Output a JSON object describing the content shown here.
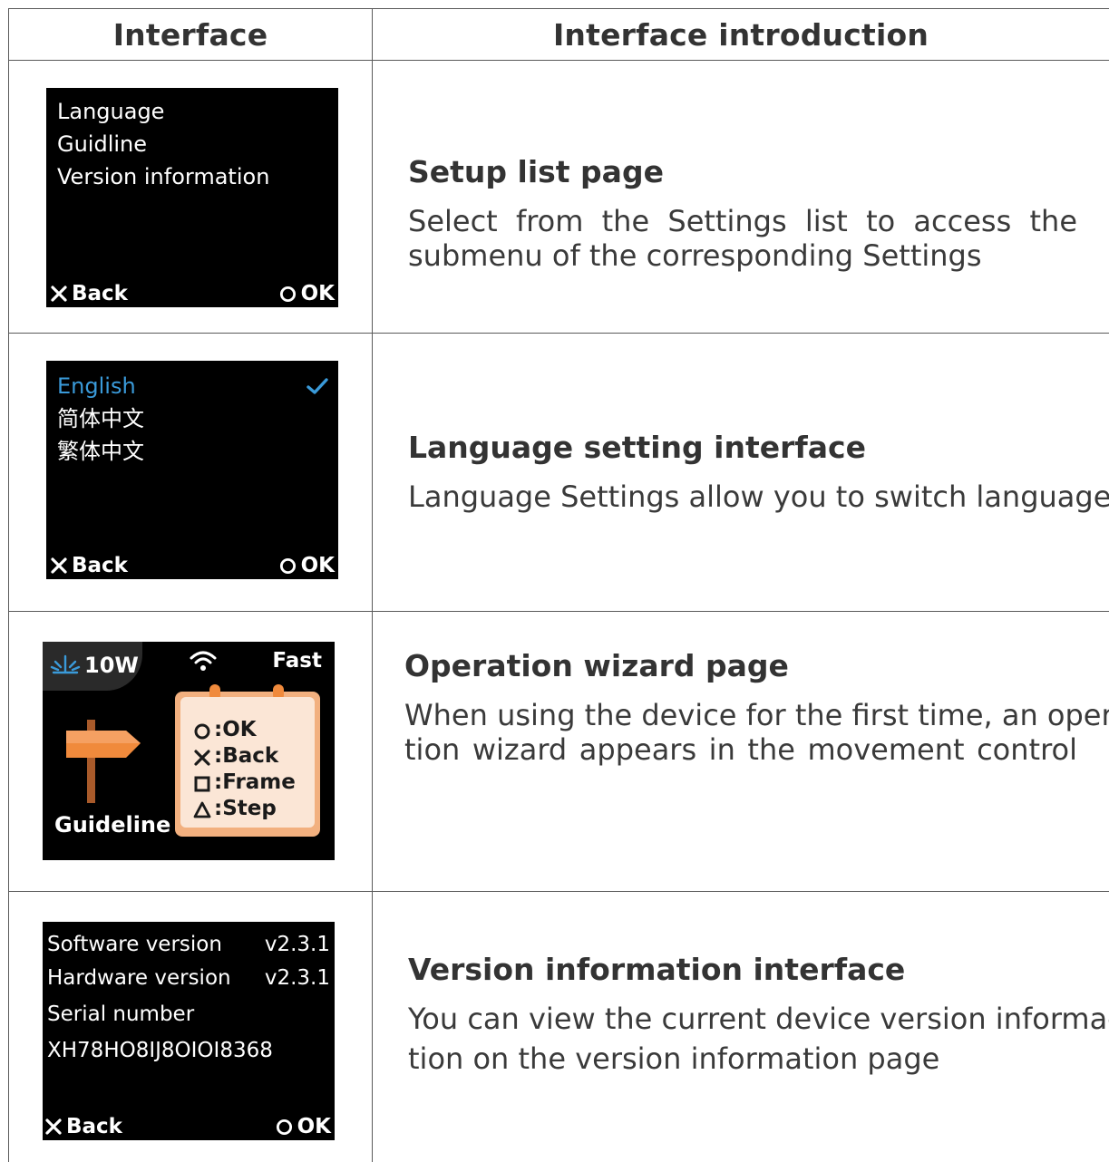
{
  "header": {
    "col1": "Interface",
    "col2": "Interface introduction"
  },
  "rows": [
    {
      "screen": {
        "items": [
          "Language",
          "Guidline",
          "Version information"
        ],
        "back": "Back",
        "ok": "OK"
      },
      "title": "Setup list page",
      "text": "Select from the Settings list to access the submenu of the corresponding Settings"
    },
    {
      "screen": {
        "items": [
          "English",
          "简体中文",
          "繁体中文"
        ],
        "selected_color": "#3a9ad9",
        "back": "Back",
        "ok": "OK"
      },
      "title": "Language setting interface",
      "text": "Language Settings allow you to switch languages"
    },
    {
      "screen": {
        "power": "10W",
        "mode": "Fast",
        "label": "Guideline",
        "hints": [
          ":OK",
          ":Back",
          ":Frame",
          ":Step"
        ]
      },
      "title": "Operation wizard page",
      "text_line1": "When using the device for the first time, an opera-",
      "text_line2": "tion wizard appears in the movement control"
    },
    {
      "screen": {
        "software_label": "Software version",
        "software_value": "v2.3.1",
        "hardware_label": "Hardware version",
        "hardware_value": "v2.3.1",
        "serial_label": "Serial number",
        "serial_value": "XH78HO8IJ8OIOI8368",
        "back": "Back",
        "ok": "OK"
      },
      "title": "Version information interface",
      "text_line1": "You can view the current device version informa-",
      "text_line2": "tion on the version information page"
    }
  ]
}
